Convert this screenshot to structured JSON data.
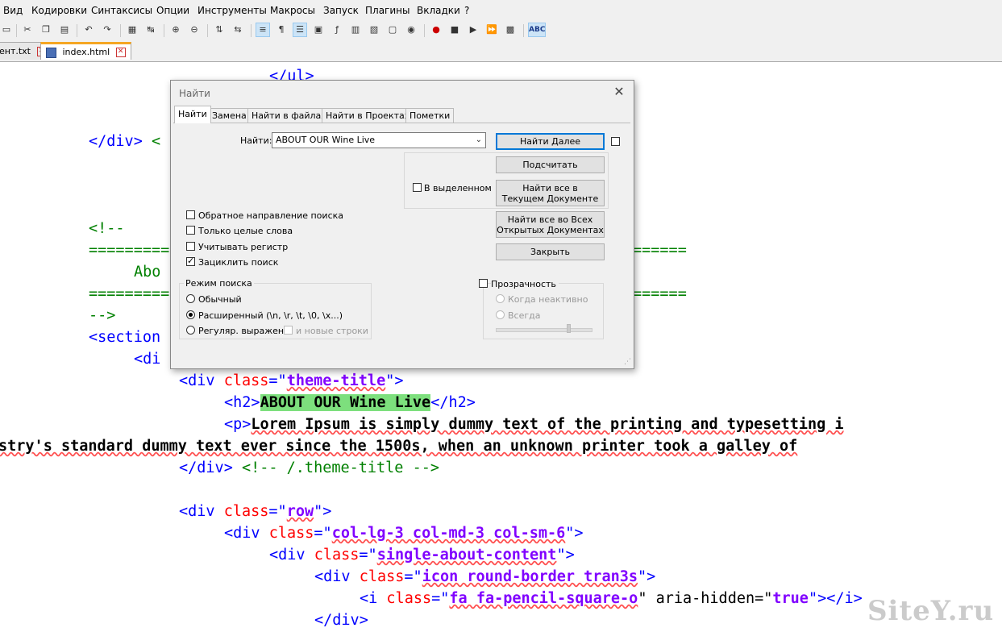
{
  "menu": [
    "Вид",
    "Кодировки",
    "Синтаксисы",
    "Опции",
    "Инструменты",
    "Макросы",
    "Запуск",
    "Плагины",
    "Вкладки",
    "?"
  ],
  "toolbar": {
    "icons": [
      "new-file-icon",
      "cut-icon",
      "copy-icon",
      "paste-icon",
      "undo-icon",
      "redo-icon",
      "find-icon",
      "replace-icon",
      "zoom-in-icon",
      "zoom-out-icon",
      "sync-vertical-icon",
      "sync-horizontal-icon",
      "word-wrap-icon",
      "show-all-chars-icon",
      "indent-guide-icon",
      "doc-map-icon",
      "function-list-icon",
      "folder-workspace-icon",
      "doc-switcher-icon",
      "monitoring-icon",
      "record-macro-icon",
      "stop-record-icon",
      "play-macro-icon",
      "run-macro-multiple-icon",
      "save-macro-icon",
      "spellcheck-icon"
    ],
    "spellcheck_label": "ABC"
  },
  "tabs": [
    {
      "label": "ент.txt",
      "active": false
    },
    {
      "label": "index.html",
      "active": true
    }
  ],
  "editor": {
    "lines": {
      "l0": "</ul>",
      "l1_tag": "</div>",
      "l1_rest": " <",
      "l2": "<!--",
      "l3": "==========",
      "l3b": "======",
      "l4": "Abo",
      "l5": "==========",
      "l5b": "======",
      "l6": "-->",
      "l7": "<section",
      "l8": "<di",
      "l9_open": "<div ",
      "l9_attr": "class",
      "l9_eq": "=\"",
      "l9_val": "theme-title",
      "l9_close": "\">",
      "l10_open": "<h2>",
      "l10_text": "ABOUT OUR Wine Live",
      "l10_close": "</h2>",
      "l11_open": "<p>",
      "l11_text": "Lorem Ipsum is simply dummy text of the printing and typesetting i",
      "l12_text": "stry's standard dummy text ever since the 1500s, when an unknown printer took a galley of",
      "l13_tag": "</div>",
      "l13_cmt": " <!-- /.theme-title -->",
      "l14_open": "<div ",
      "l14_attr": "class",
      "l14_eq": "=\"",
      "l14_val": "row",
      "l14_close": "\">",
      "l15_open": "<div ",
      "l15_attr": "class",
      "l15_eq": "=\"",
      "l15_val": "col-lg-3 col-md-3 col-sm-6",
      "l15_close": "\">",
      "l16_open": "<div ",
      "l16_attr": "class",
      "l16_eq": "=\"",
      "l16_val": "single-about-content",
      "l16_close": "\">",
      "l17_open": "<div ",
      "l17_attr": "class",
      "l17_eq": "=\"",
      "l17_val": "icon round-border tran3s",
      "l17_close": "\">",
      "l18_open": "<i ",
      "l18_attr": "class",
      "l18_eq": "=\"",
      "l18_val": "fa fa-pencil-square-o",
      "l18_mid": "\" aria-hidden=\"",
      "l18_val2": "true",
      "l18_close": "\"></i>",
      "l19": "</div>"
    }
  },
  "dialog": {
    "title": "Найти",
    "close_glyph": "✕",
    "tabs": [
      "Найти",
      "Замена",
      "Найти в файлах",
      "Найти в Проектах",
      "Пометки"
    ],
    "find_label": "Найти:",
    "find_value": "ABOUT OUR Wine Live",
    "dropdown_glyph": "⌄",
    "buttons": {
      "find_next": "Найти Далее",
      "count": "Подсчитать",
      "find_all_current_1": "Найти все в",
      "find_all_current_2": "Текущем Документе",
      "find_all_open_1": "Найти все во Всех",
      "find_all_open_2": "Открытых Документах",
      "close": "Закрыть"
    },
    "in_selection": "В выделенном",
    "options": {
      "backward": {
        "label": "Обратное направление поиска",
        "checked": false
      },
      "whole_word": {
        "label": "Только целые слова",
        "checked": false
      },
      "match_case": {
        "label": "Учитывать регистр",
        "checked": false
      },
      "wrap": {
        "label": "Зациклить поиск",
        "checked": true
      }
    },
    "search_mode": {
      "title": "Режим поиска",
      "normal": "Обычный",
      "extended": "Расширенный (\\n, \\r, \\t, \\0, \\x...)",
      "regex": "Регуляр. выражен.",
      "newline": "и новые строки",
      "selected": "extended"
    },
    "transparency": {
      "label": "Прозрачность",
      "on_lose_focus": "Когда неактивно",
      "always": "Всегда",
      "enabled": false,
      "level": 0.75
    }
  },
  "watermark": "SiteY.ru",
  "colors": {
    "tag": "#0000ff",
    "attr": "#ff0000",
    "value": "#8000ff",
    "comment": "#008000",
    "highlight": "#7ddf7d",
    "accent": "#0078d7"
  }
}
